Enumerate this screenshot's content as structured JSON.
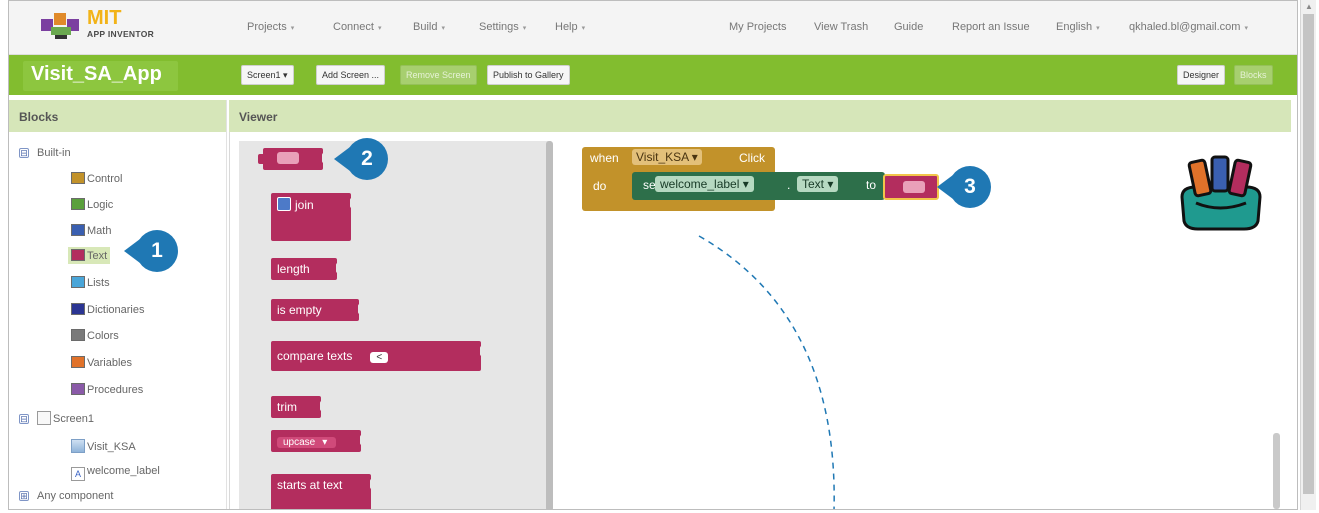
{
  "logo": {
    "brand": "MIT",
    "product": "APP INVENTOR"
  },
  "top_menu": {
    "left": [
      {
        "label": "Projects",
        "caret": "▾"
      },
      {
        "label": "Connect",
        "caret": "▾"
      },
      {
        "label": "Build",
        "caret": "▾"
      },
      {
        "label": "Settings",
        "caret": "▾"
      },
      {
        "label": "Help",
        "caret": "▾"
      }
    ],
    "right": [
      {
        "label": "My Projects"
      },
      {
        "label": "View Trash"
      },
      {
        "label": "Guide"
      },
      {
        "label": "Report an Issue"
      },
      {
        "label": "English",
        "caret": "▾"
      },
      {
        "label": "qkhaled.bl@gmail.com",
        "caret": "▾"
      }
    ]
  },
  "toolbar": {
    "project_name": "Visit_SA_App",
    "screen_select": "Screen1 ▾",
    "add_screen": "Add Screen ...",
    "remove_screen": "Remove Screen",
    "publish": "Publish to Gallery",
    "designer": "Designer",
    "blocks": "Blocks"
  },
  "blocks_panel": {
    "title": "Blocks",
    "builtin": {
      "toggle": "⊟",
      "label": "Built-in",
      "items": [
        {
          "label": "Control",
          "color": "#c2922a"
        },
        {
          "label": "Logic",
          "color": "#5aa03c"
        },
        {
          "label": "Math",
          "color": "#3a5fb0"
        },
        {
          "label": "Text",
          "color": "#b32d5e",
          "selected": true
        },
        {
          "label": "Lists",
          "color": "#4aa6d9"
        },
        {
          "label": "Dictionaries",
          "color": "#2b3593"
        },
        {
          "label": "Colors",
          "color": "#7a7a7a"
        },
        {
          "label": "Variables",
          "color": "#e0722a"
        },
        {
          "label": "Procedures",
          "color": "#8a5aa8"
        }
      ]
    },
    "screen": {
      "toggle": "⊟",
      "label": "Screen1",
      "components": [
        {
          "label": "Visit_KSA"
        },
        {
          "label": "welcome_label"
        }
      ]
    },
    "any_component": {
      "toggle": "⊞",
      "label": "Any component"
    }
  },
  "viewer": {
    "title": "Viewer",
    "flyout_blocks": [
      {
        "label": ""
      },
      {
        "label": "join"
      },
      {
        "label": "length"
      },
      {
        "label": "is empty"
      },
      {
        "label": "compare texts",
        "operator": "<"
      },
      {
        "label": "trim"
      },
      {
        "label": "upcase",
        "caret": "▾"
      },
      {
        "label": "starts at  text"
      }
    ],
    "event_block": {
      "when": "when",
      "component": "Visit_KSA ▾",
      "event": "Click",
      "do": "do",
      "set": "set",
      "target": "welcome_label ▾",
      "dot": ".",
      "property": "Text ▾",
      "to": "to"
    }
  },
  "callouts": [
    "1",
    "2",
    "3"
  ]
}
